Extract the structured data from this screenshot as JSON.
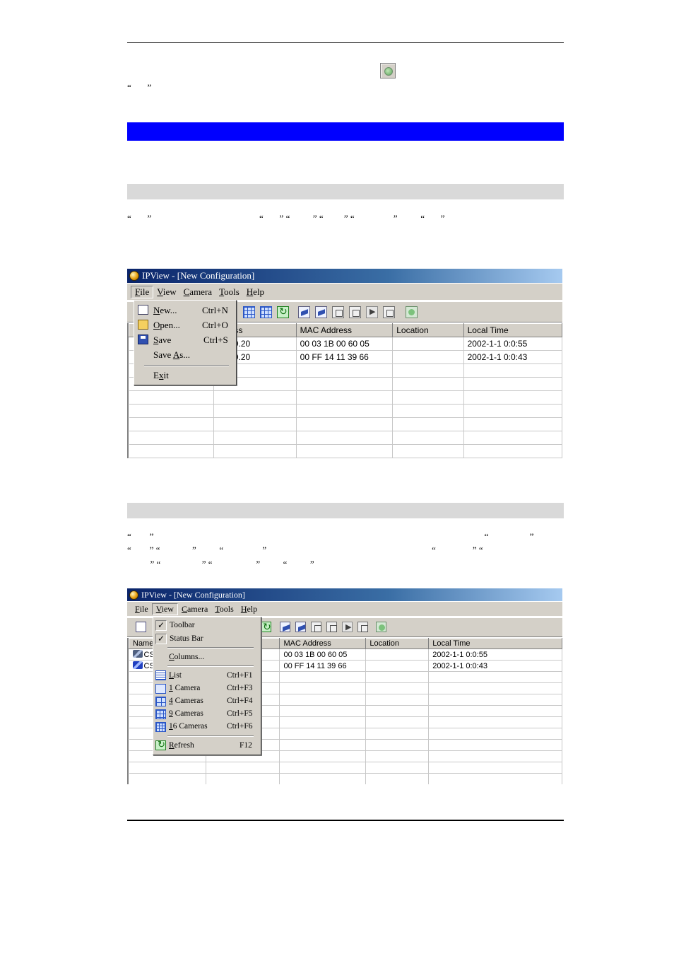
{
  "page": {
    "top_quotes": "“       ”",
    "section1_quotes": "“       ”                                               “       ” “          ” “         ” “                 ”          “       ”",
    "section2_line1": "“        ”                                                                                                                                                “                  ”",
    "section2_line2": "“        ” “              ”          “                 ”                                                                        “                ” “",
    "section2_line3": "          ” “                  ” “                   ”          “          ”"
  },
  "screenshot1": {
    "title": "IPView - [New Configuration]",
    "menu": [
      {
        "label": "File",
        "u": "F",
        "rest": "ile"
      },
      {
        "label": "View",
        "u": "V",
        "rest": "iew"
      },
      {
        "label": "Camera",
        "u": "C",
        "rest": "amera"
      },
      {
        "label": "Tools",
        "u": "T",
        "rest": "ools"
      },
      {
        "label": "Help",
        "u": "H",
        "rest": "elp"
      }
    ],
    "columns": [
      "",
      "ddress",
      "MAC Address",
      "Location",
      "Local Time"
    ],
    "rows": [
      {
        "icon": "camera-icon",
        "name": "",
        "ip": "168.0.20",
        "mac": "00 03 1B 00 60 05",
        "location": "",
        "time": "2002-1-1  0:0:55"
      },
      {
        "icon": "camera-icon",
        "name": "",
        "ip": "168.0.20",
        "mac": "00 FF 14 11 39 66",
        "location": "",
        "time": "2002-1-1  0:0:43"
      }
    ],
    "file_menu": {
      "new": {
        "u": "N",
        "rest": "ew...",
        "shortcut": "Ctrl+N"
      },
      "open": {
        "u": "O",
        "rest": "pen...",
        "shortcut": "Ctrl+O"
      },
      "save": {
        "u": "S",
        "rest": "ave",
        "shortcut": "Ctrl+S"
      },
      "saveas": {
        "pre": "Save ",
        "u": "A",
        "rest": "s..."
      },
      "exit": {
        "pre": "E",
        "u": "x",
        "rest": "it"
      }
    }
  },
  "screenshot2": {
    "title": "IPView - [New Configuration]",
    "menu": [
      {
        "label": "File",
        "u": "F",
        "rest": "ile"
      },
      {
        "label": "View",
        "u": "V",
        "rest": "iew"
      },
      {
        "label": "Camera",
        "u": "C",
        "rest": "amera"
      },
      {
        "label": "Tools",
        "u": "T",
        "rest": "ools"
      },
      {
        "label": "Help",
        "u": "H",
        "rest": "elp"
      }
    ],
    "columns": [
      "Name",
      "",
      "MAC Address",
      "Location",
      "Local Time"
    ],
    "rows": [
      {
        "name": "CS",
        "mac": "00 03 1B 00 60 05",
        "location": "",
        "time": "2002-1-1  0:0:55"
      },
      {
        "name": "CS",
        "mac": "00 FF 14 11 39 66",
        "location": "",
        "time": "2002-1-1  0:0:43"
      }
    ],
    "view_menu": {
      "toolbar": "Toolbar",
      "statusbar": "Status Bar",
      "columns": {
        "u": "C",
        "rest": "olumns..."
      },
      "list": {
        "u": "L",
        "rest": "ist",
        "shortcut": "Ctrl+F1"
      },
      "cam1": {
        "u": "1",
        "rest": " Camera",
        "shortcut": "Ctrl+F3"
      },
      "cam4": {
        "u": "4",
        "rest": " Cameras",
        "shortcut": "Ctrl+F4"
      },
      "cam9": {
        "u": "9",
        "rest": " Cameras",
        "shortcut": "Ctrl+F5"
      },
      "cam16": {
        "u": "1",
        "rest": "6 Cameras",
        "shortcut": "Ctrl+F6"
      },
      "refresh": {
        "u": "R",
        "rest": "efresh",
        "shortcut": "F12"
      },
      "check": "✓"
    }
  }
}
